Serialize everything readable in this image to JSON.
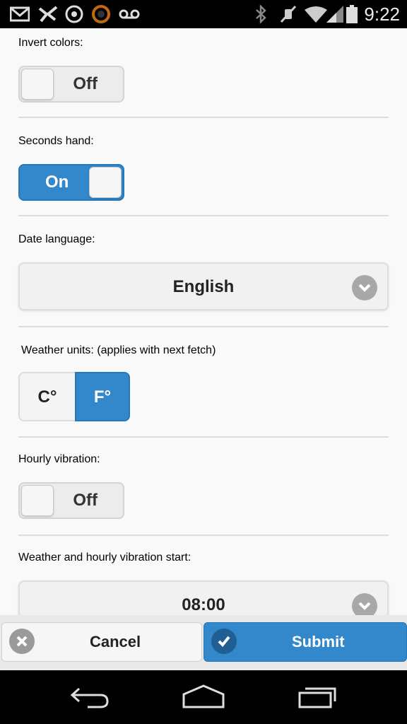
{
  "status_bar": {
    "time": "9:22",
    "icons": [
      "gmail-icon",
      "app-notification-icon",
      "target-icon",
      "circle-app-icon",
      "voicemail-icon",
      "bluetooth-icon",
      "mute-icon",
      "wifi-icon",
      "signal-icon",
      "battery-icon"
    ]
  },
  "settings": {
    "invert_colors": {
      "label": "Invert colors:",
      "state": "Off"
    },
    "seconds_hand": {
      "label": "Seconds hand:",
      "state": "On"
    },
    "date_language": {
      "label": "Date language:",
      "value": "English"
    },
    "weather_units": {
      "label": "Weather units: (applies with next fetch)",
      "options": [
        "C°",
        "F°"
      ],
      "selected": "F°"
    },
    "hourly_vibration": {
      "label": "Hourly vibration:",
      "state": "Off"
    },
    "vibration_start": {
      "label": "Weather and hourly vibration start:",
      "value": "08:00"
    }
  },
  "buttons": {
    "cancel": "Cancel",
    "submit": "Submit"
  },
  "colors": {
    "accent": "#3388cc",
    "status_bar": "#000000",
    "nav_bar": "#000000"
  },
  "nav": {
    "icons": [
      "back-icon",
      "home-icon",
      "recent-apps-icon"
    ]
  }
}
